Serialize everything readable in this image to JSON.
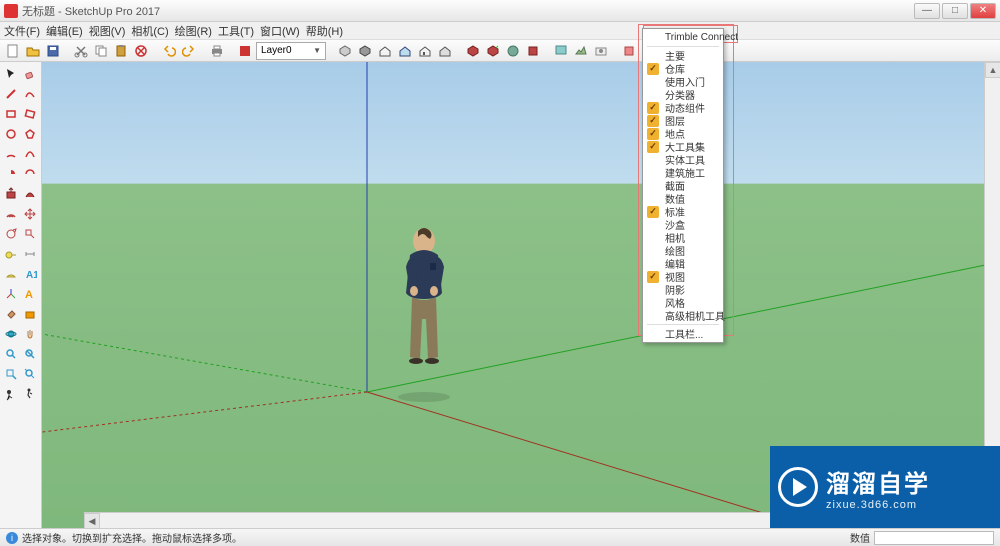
{
  "window": {
    "title": "无标题 - SketchUp Pro 2017",
    "min": "—",
    "max": "□",
    "close": "✕"
  },
  "menu": [
    "文件(F)",
    "编辑(E)",
    "视图(V)",
    "相机(C)",
    "绘图(R)",
    "工具(T)",
    "窗口(W)",
    "帮助(H)"
  ],
  "layer": {
    "label": "Layer0"
  },
  "context": [
    {
      "label": "Trimble Connect",
      "checked": false
    },
    {
      "label": "主要",
      "checked": false
    },
    {
      "label": "仓库",
      "checked": true
    },
    {
      "label": "使用入门",
      "checked": false
    },
    {
      "label": "分类器",
      "checked": false
    },
    {
      "label": "动态组件",
      "checked": true
    },
    {
      "label": "图层",
      "checked": true
    },
    {
      "label": "地点",
      "checked": true
    },
    {
      "label": "大工具集",
      "checked": true
    },
    {
      "label": "实体工具",
      "checked": false
    },
    {
      "label": "建筑施工",
      "checked": false
    },
    {
      "label": "截面",
      "checked": false
    },
    {
      "label": "数值",
      "checked": false
    },
    {
      "label": "标准",
      "checked": true
    },
    {
      "label": "沙盒",
      "checked": false
    },
    {
      "label": "相机",
      "checked": false
    },
    {
      "label": "绘图",
      "checked": false
    },
    {
      "label": "编辑",
      "checked": false
    },
    {
      "label": "视图",
      "checked": true
    },
    {
      "label": "阴影",
      "checked": false
    },
    {
      "label": "风格",
      "checked": false
    },
    {
      "label": "高级相机工具",
      "checked": false
    },
    {
      "label": "工具栏...",
      "checked": false
    }
  ],
  "status": {
    "hint": "选择对象。切换到扩充选择。拖动鼠标选择多项。",
    "metric": "数值"
  },
  "watermark": {
    "big": "溜溜自学",
    "small": "zixue.3d66.com"
  },
  "colors": {
    "accent": "#0a5fa8",
    "highlight": "#e87878",
    "check": "#f0b030"
  }
}
